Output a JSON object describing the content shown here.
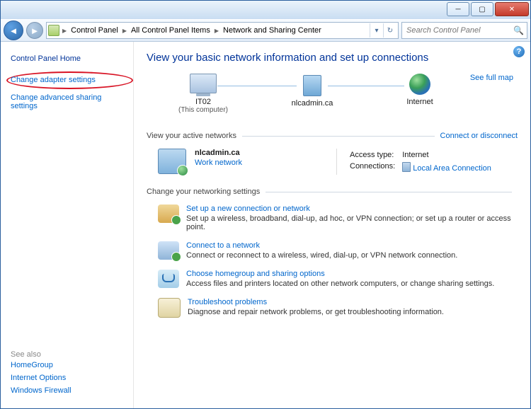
{
  "breadcrumb": {
    "item1": "Control Panel",
    "item2": "All Control Panel Items",
    "item3": "Network and Sharing Center"
  },
  "search": {
    "placeholder": "Search Control Panel"
  },
  "sidebar": {
    "home": "Control Panel Home",
    "links": {
      "adapter": "Change adapter settings",
      "advanced": "Change advanced sharing settings"
    },
    "seealso_title": "See also",
    "seealso": {
      "homegroup": "HomeGroup",
      "inetopt": "Internet Options",
      "firewall": "Windows Firewall"
    }
  },
  "page_title": "View your basic network information and set up connections",
  "full_map": "See full map",
  "nodes": {
    "pc": {
      "label": "IT02",
      "sub": "(This computer)"
    },
    "gw": {
      "label": "nlcadmin.ca"
    },
    "net": {
      "label": "Internet"
    }
  },
  "active_hdr": "View your active networks",
  "connect_disconnect": "Connect or disconnect",
  "network": {
    "name": "nlcadmin.ca",
    "type": "Work network",
    "access_lbl": "Access type:",
    "access_val": "Internet",
    "conn_lbl": "Connections:",
    "conn_val": "Local Area Connection"
  },
  "settings_hdr": "Change your networking settings",
  "settings": {
    "s1": {
      "title": "Set up a new connection or network",
      "desc": "Set up a wireless, broadband, dial-up, ad hoc, or VPN connection; or set up a router or access point."
    },
    "s2": {
      "title": "Connect to a network",
      "desc": "Connect or reconnect to a wireless, wired, dial-up, or VPN network connection."
    },
    "s3": {
      "title": "Choose homegroup and sharing options",
      "desc": "Access files and printers located on other network computers, or change sharing settings."
    },
    "s4": {
      "title": "Troubleshoot problems",
      "desc": "Diagnose and repair network problems, or get troubleshooting information."
    }
  }
}
